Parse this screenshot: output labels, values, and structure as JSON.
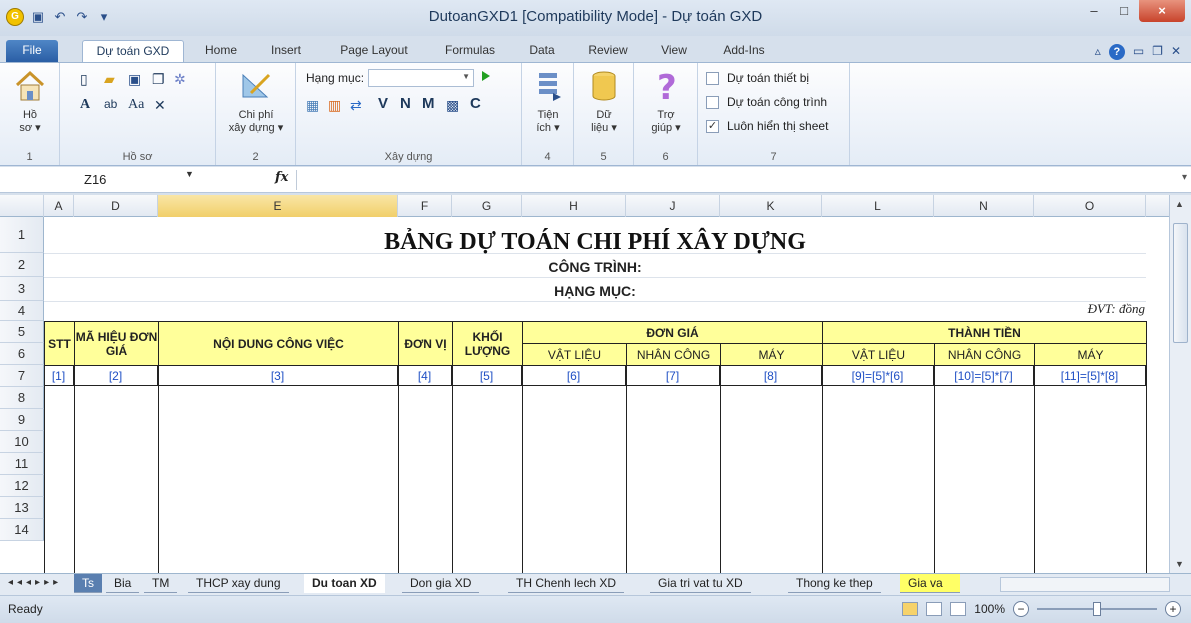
{
  "window": {
    "title": "DutoanGXD1  [Compatibility Mode]  -  Dự toán GXD",
    "app_logo": "G",
    "controls": [
      "–",
      "□",
      "×"
    ]
  },
  "ribbon_tabs": {
    "file": "File",
    "items": [
      "Dự toán GXD",
      "Home",
      "Insert",
      "Page Layout",
      "Formulas",
      "Data",
      "Review",
      "View",
      "Add-Ins"
    ]
  },
  "ribbon": {
    "groups": [
      {
        "label": "1",
        "buttons": [
          "Hồ sơ ▾"
        ]
      },
      {
        "label": "Hồ sơ"
      },
      {
        "label": "2",
        "buttons": [
          "Chi phí xây dựng ▾"
        ]
      },
      {
        "label": "Xây dựng"
      },
      {
        "label": "4",
        "buttons": [
          "Tiện ích ▾"
        ]
      },
      {
        "label": "5",
        "buttons": [
          "Dữ liệu ▾"
        ]
      },
      {
        "label": "6",
        "buttons": [
          "Trợ giúp ▾"
        ]
      },
      {
        "label": "7"
      }
    ],
    "ho_so_label": "Hồ",
    "ho_so_sub": "sơ ▾",
    "chi_phi_1": "Chi phí",
    "chi_phi_2": "xây dựng ▾",
    "tien_1": "Tiện",
    "tien_2": "ích ▾",
    "du_1": "Dữ",
    "du_2": "liệu ▾",
    "tro_1": "Trợ",
    "tro_2": "giúp ▾",
    "hang_muc_label": "Hạng mục:",
    "letters": [
      "V",
      "N",
      "M",
      "C"
    ],
    "checkboxes": [
      {
        "label": "Dự toán thiết bị",
        "checked": false
      },
      {
        "label": "Dự toán công trình",
        "checked": false
      },
      {
        "label": "Luôn hiển thị sheet",
        "checked": true
      }
    ]
  },
  "formula_bar": {
    "name_box": "Z16",
    "fx": "fx",
    "value": ""
  },
  "columns": [
    "A",
    "D",
    "E",
    "F",
    "G",
    "H",
    "J",
    "K",
    "L",
    "N",
    "O"
  ],
  "rows": [
    "1",
    "2",
    "3",
    "4",
    "5",
    "6",
    "7",
    "8",
    "9",
    "10",
    "11",
    "12",
    "13",
    "14"
  ],
  "sheet": {
    "title": "BẢNG DỰ TOÁN CHI PHÍ XÂY DỰNG",
    "cong_trinh": "CÔNG TRÌNH:",
    "hang_muc": "HẠNG MỤC:",
    "unit": "ĐVT: đồng",
    "headers": {
      "stt": "STT",
      "ma_hieu": "MÃ HIỆU ĐƠN GIÁ",
      "noi_dung": "NỘI DUNG CÔNG VIỆC",
      "don_vi": "ĐƠN VỊ",
      "khoi_luong": "KHỐI LƯỢNG",
      "don_gia": "ĐƠN GIÁ",
      "thanh_tien": "THÀNH TIỀN",
      "vat_lieu": "VẬT LIỆU",
      "nhan_cong": "NHÂN CÔNG",
      "may": "MÁY",
      "vat_lieu2": "VẬT LIỆU",
      "nhan_cong2": "NHÂN CÔNG",
      "may2": "MÁY"
    },
    "index_row": [
      "[1]",
      "[2]",
      "[3]",
      "[4]",
      "[5]",
      "[6]",
      "[7]",
      "[8]",
      "[9]=[5]*[6]",
      "[10]=[5]*[7]",
      "[11]=[5]*[8]"
    ]
  },
  "sheet_tabs": [
    "Ts",
    "Bia",
    "TM",
    "THCP xay dung",
    "Du toan XD",
    "Don gia XD",
    "TH Chenh lech XD",
    "Gia tri vat tu XD",
    "Thong ke thep",
    "Gia va"
  ],
  "status": {
    "ready": "Ready",
    "zoom": "100%"
  }
}
